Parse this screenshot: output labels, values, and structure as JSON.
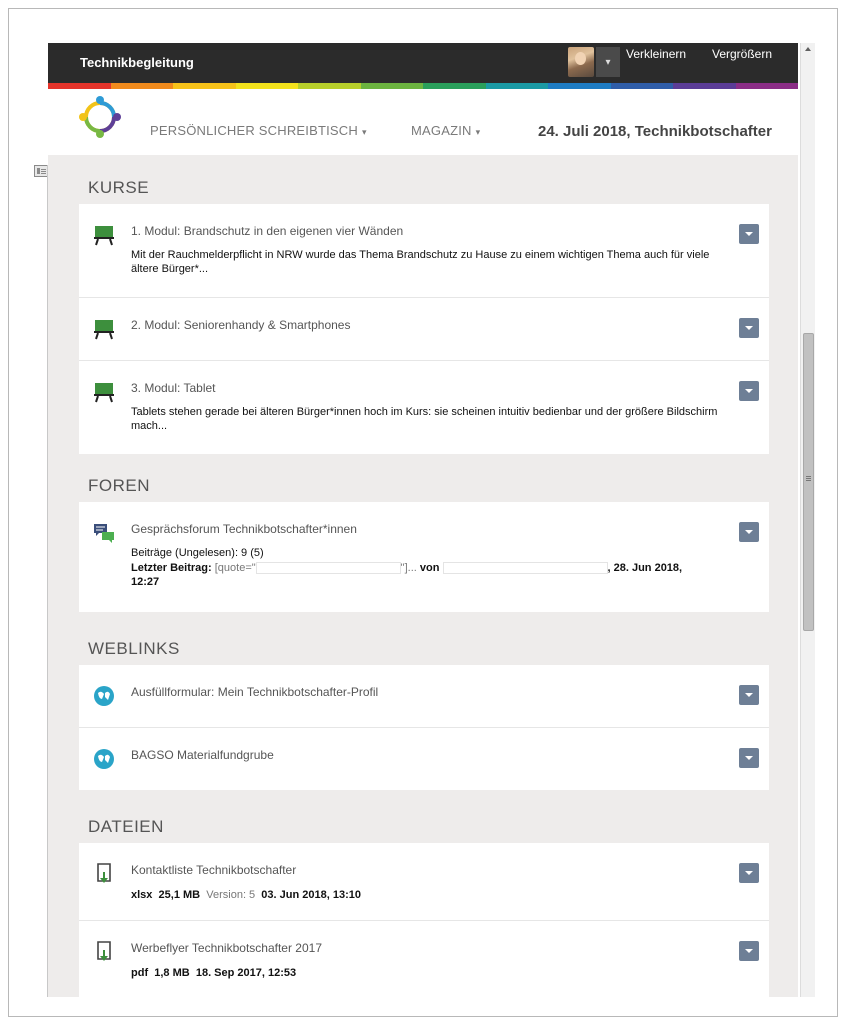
{
  "topbar": {
    "brand": "Technikbegleitung",
    "zoom_out": "Verkleinern",
    "zoom_in": "Vergrößern",
    "avatar_menu_caret": "▾"
  },
  "rainbow_colors": [
    "#e5342b",
    "#f08a1c",
    "#f6c21a",
    "#f3e21c",
    "#b7cf2a",
    "#6cb43f",
    "#2a9f5b",
    "#1b9aa4",
    "#1e7cc3",
    "#2f5da8",
    "#5b3c96",
    "#8b2d86"
  ],
  "header": {
    "nav": [
      {
        "label": "PERSÖNLICHER SCHREIBTISCH",
        "caret": "▾"
      },
      {
        "label": "MAGAZIN",
        "caret": "▾"
      }
    ],
    "date_title": "24. Juli 2018, Technikbotschafter"
  },
  "sections": {
    "kurse": {
      "title": "KURSE",
      "items": [
        {
          "title": "1. Modul: Brandschutz in den eigenen vier Wänden",
          "desc": "Mit der Rauchmelderpflicht in NRW wurde das Thema Brandschutz zu Hause zu einem wichtigen Thema auch für viele ältere Bürger*..."
        },
        {
          "title": "2. Modul: Seniorenhandy & Smartphones",
          "desc": ""
        },
        {
          "title": "3. Modul: Tablet",
          "desc": "Tablets stehen gerade bei älteren Bürger*innen hoch im Kurs: sie scheinen intuitiv bedienbar und der größere Bildschirm mach..."
        }
      ]
    },
    "foren": {
      "title": "FOREN",
      "items": [
        {
          "title": "Gesprächsforum Technikbotschafter*innen",
          "unread": "Beiträge (Ungelesen): 9 (5)",
          "last_label": "Letzter Beitrag:",
          "last_quote": "[quote=\"",
          "last_quote_end": "\"]...",
          "by": "von",
          "date": ", 28. Jun 2018,",
          "time": "12:27"
        }
      ]
    },
    "weblinks": {
      "title": "WEBLINKS",
      "items": [
        {
          "title": "Ausfüllformular: Mein Technikbotschafter-Profil"
        },
        {
          "title": "BAGSO Materialfundgrube"
        }
      ]
    },
    "dateien": {
      "title": "DATEIEN",
      "items": [
        {
          "title": "Kontaktliste Technikbotschafter",
          "type": "xlsx",
          "size": "25,1 MB",
          "version_label": "Version: 5",
          "date": "03. Jun 2018, 13:10"
        },
        {
          "title": "Werbeflyer Technikbotschafter 2017",
          "type": "pdf",
          "size": "1,8 MB",
          "date": "18. Sep 2017, 12:53"
        }
      ]
    }
  },
  "icons": {
    "course": "chalkboard-icon",
    "forum": "forum-chat-icon",
    "weblink": "weblink-icon",
    "file": "file-download-icon",
    "action": "chevron-down-icon"
  },
  "colors": {
    "action_button": "#6e7f96",
    "unread_orange": "#e58a3a",
    "course_green": "#3d8f3d",
    "weblink_blue": "#2aa4c8"
  }
}
